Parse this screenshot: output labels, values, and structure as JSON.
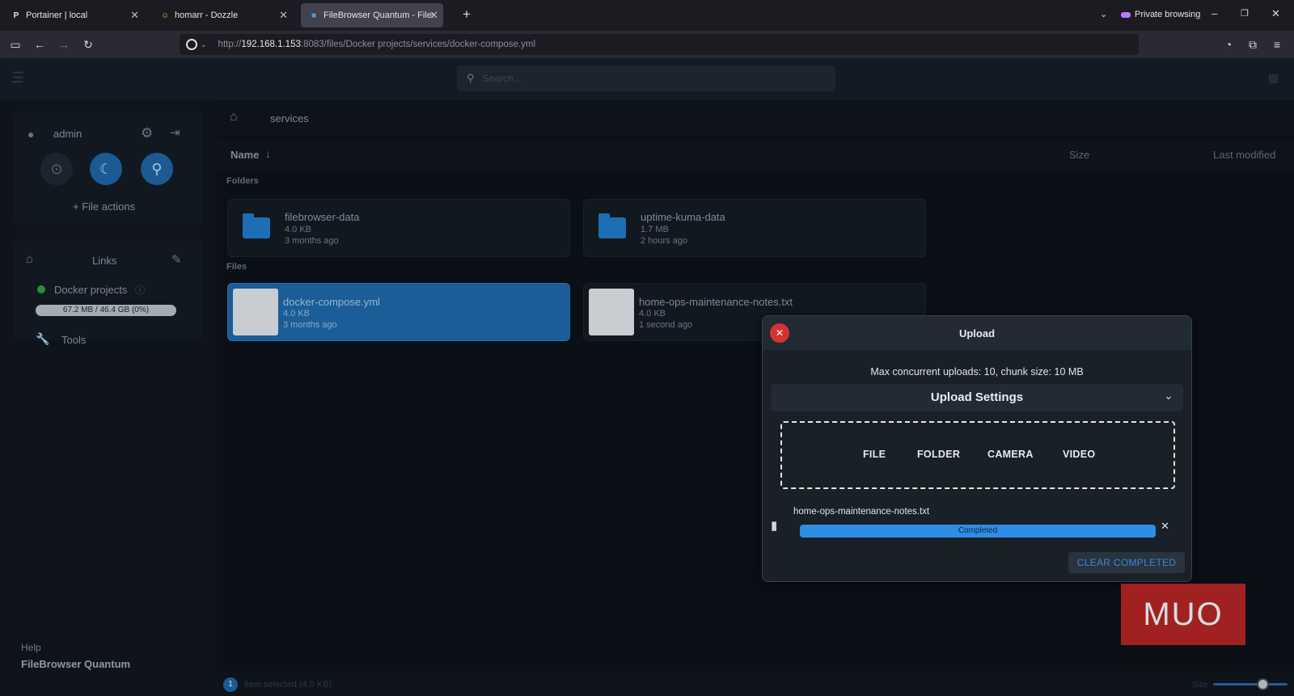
{
  "browser": {
    "tabs": [
      {
        "label": "Portainer | local",
        "icon": "P"
      },
      {
        "label": "homarr - Dozzle",
        "icon": "☺"
      },
      {
        "label": "FileBrowser Quantum - Files - d",
        "icon": "■"
      }
    ],
    "private_label": "Private browsing",
    "url_prefix": "http://",
    "url_host": "192.168.1.153",
    "url_rest": ":8083/files/Docker projects/services/docker-compose.yml"
  },
  "header": {
    "search_placeholder": "Search..."
  },
  "sidebar": {
    "username": "admin",
    "file_actions": "+ File actions",
    "links_title": "Links",
    "source_name": "Docker projects",
    "source_usage": "67.2 MB / 46.4 GB (0%)",
    "tools_label": "Tools",
    "help_label": "Help",
    "app_name": "FileBrowser Quantum"
  },
  "main": {
    "breadcrumb": "services",
    "col_name": "Name",
    "col_size": "Size",
    "col_modified": "Last modified",
    "folders_title": "Folders",
    "files_title": "Files",
    "folders": [
      {
        "name": "filebrowser-data",
        "size": "4.0 KB",
        "modified": "3 months ago"
      },
      {
        "name": "uptime-kuma-data",
        "size": "1.7 MB",
        "modified": "2 hours ago"
      }
    ],
    "files": [
      {
        "name": "docker-compose.yml",
        "size": "4.0 KB",
        "modified": "3 months ago"
      },
      {
        "name": "home-ops-maintenance-notes.txt",
        "size": "4.0 KB",
        "modified": "1 second ago"
      }
    ]
  },
  "upload": {
    "title": "Upload",
    "info": "Max concurrent uploads: 10, chunk size: 10 MB",
    "settings_label": "Upload Settings",
    "buttons": [
      "FILE",
      "FOLDER",
      "CAMERA",
      "VIDEO"
    ],
    "file_name": "home-ops-maintenance-notes.txt",
    "status": "Completed",
    "progress": 1.0,
    "clear_label": "CLEAR COMPLETED"
  },
  "status_bar": {
    "selected_count": "1",
    "selected_text": "item selected (4.0 KB)",
    "size_label": "Size"
  },
  "watermark": "MUO",
  "colors": {
    "accent": "#1d6fb5",
    "progress": "#2f8de4",
    "close": "#d23434"
  }
}
